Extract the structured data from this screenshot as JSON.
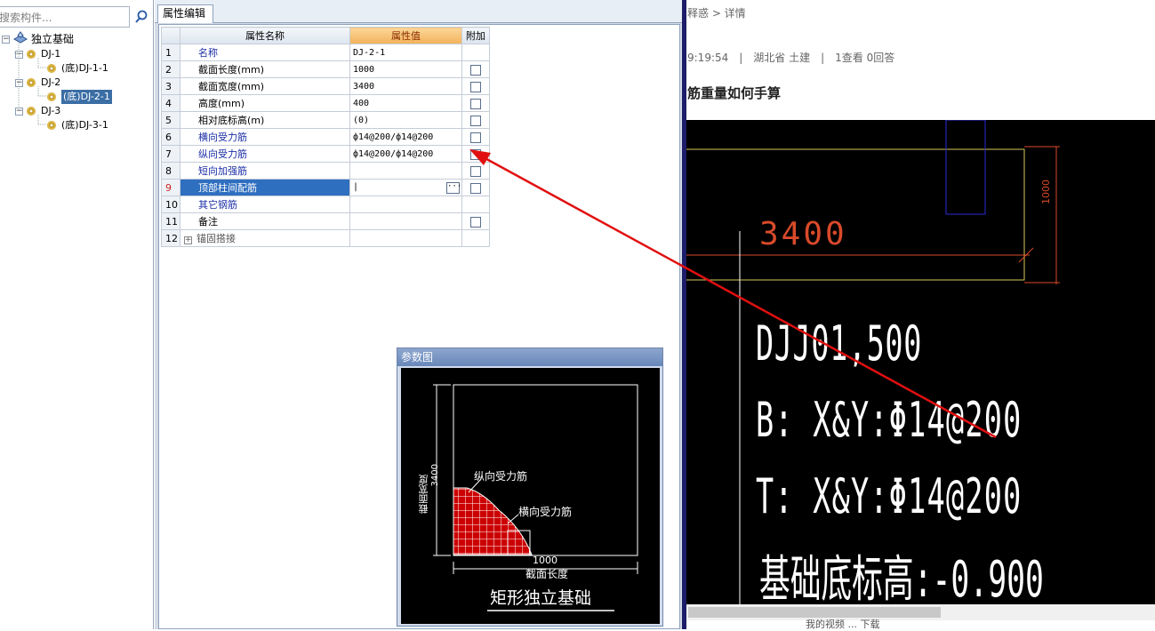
{
  "left_panel": {
    "search_placeholder": "搜索构件...",
    "tree": [
      {
        "label": "独立基础",
        "level": 0
      },
      {
        "label": "DJ-1",
        "level": 1
      },
      {
        "label": "(底)DJ-1-1",
        "level": 2
      },
      {
        "label": "DJ-2",
        "level": 1
      },
      {
        "label": "(底)DJ-2-1",
        "level": 2,
        "selected": true
      },
      {
        "label": "DJ-3",
        "level": 1
      },
      {
        "label": "(底)DJ-3-1",
        "level": 2
      }
    ]
  },
  "property_editor": {
    "tab_label": "属性编辑",
    "headers": {
      "name": "属性名称",
      "value": "属性值",
      "extra": "附加"
    },
    "rows": [
      {
        "num": "1",
        "name": "名称",
        "value": "DJ-2-1",
        "color": "#1c2fa6",
        "checkbox": false
      },
      {
        "num": "2",
        "name": "截面长度(mm)",
        "value": "1000",
        "color": "#000000",
        "checkbox": true
      },
      {
        "num": "3",
        "name": "截面宽度(mm)",
        "value": "3400",
        "color": "#000000",
        "checkbox": true
      },
      {
        "num": "4",
        "name": "高度(mm)",
        "value": "400",
        "color": "#000000",
        "checkbox": true
      },
      {
        "num": "5",
        "name": "相对底标高(m)",
        "value": "(0)",
        "color": "#000000",
        "checkbox": true
      },
      {
        "num": "6",
        "name": "横向受力筋",
        "value": "ф14@200/ф14@200",
        "color": "#1c2fa6",
        "checkbox": true
      },
      {
        "num": "7",
        "name": "纵向受力筋",
        "value": "ф14@200/ф14@200",
        "color": "#1c2fa6",
        "checkbox": true
      },
      {
        "num": "8",
        "name": "短向加强筋",
        "value": "",
        "color": "#1c2fa6",
        "checkbox": true
      },
      {
        "num": "9",
        "name": "顶部柱间配筋",
        "value": "",
        "color": "#1c2fa6",
        "checkbox": true,
        "selected": true
      },
      {
        "num": "10",
        "name": "其它钢筋",
        "value": "",
        "color": "#1c2fa6",
        "checkbox": false
      },
      {
        "num": "11",
        "name": "备注",
        "value": "",
        "color": "#000000",
        "checkbox": true
      },
      {
        "num": "12",
        "name": "锚固搭接",
        "value": "",
        "color": "#555555",
        "checkbox": false,
        "expandable": true
      }
    ]
  },
  "param_diagram": {
    "title": "参数图",
    "label_width": "截面宽度",
    "label_width_value": "3400",
    "label_length": "截面长度",
    "label_length_value": "1000",
    "label_long_bar": "纵向受力筋",
    "label_trans_bar": "横向受力筋",
    "caption": "矩形独立基础"
  },
  "right_panel": {
    "breadcrumb": "释惑 > 详情",
    "meta": "9:19:54　|　湖北省  土建　|　1查看  0回答",
    "question_title": "筋重量如何手算",
    "cad": {
      "dim_3400": "3400",
      "dim_1000": "1000",
      "line1": "DJJ01,500",
      "line2": "B: X&Y:Φ14@200",
      "line3": "T: X&Y:Φ14@200",
      "line4": "基础底标高:-0.900"
    },
    "bottom_bar": "我的视频 ... 下载"
  },
  "colors": {
    "arrow": "#e01010",
    "cad_yellow": "#d8c85a",
    "cad_red": "#d84a2a",
    "cad_blue": "#2a2ad8"
  }
}
